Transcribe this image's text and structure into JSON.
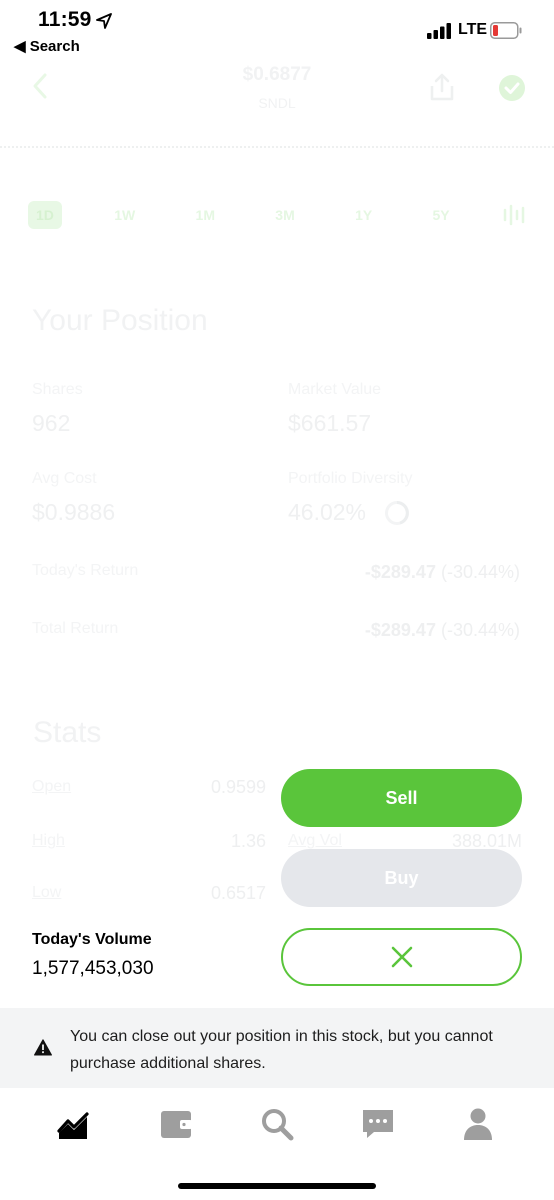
{
  "status_bar": {
    "time": "11:59",
    "back_label": "◀ Search",
    "network": "LTE"
  },
  "header": {
    "price": "$0.6877",
    "symbol": "SNDL"
  },
  "ranges": [
    "1D",
    "1W",
    "1M",
    "3M",
    "1Y",
    "5Y"
  ],
  "position": {
    "title": "Your Position",
    "shares_label": "Shares",
    "shares_value": "962",
    "market_value_label": "Market Value",
    "market_value": "$661.57",
    "avg_cost_label": "Avg Cost",
    "avg_cost": "$0.9886",
    "diversity_label": "Portfolio Diversity",
    "diversity": "46.02%",
    "todays_return_label": "Today's Return",
    "todays_return_amount": "-$289.47",
    "todays_return_pct": "(-30.44%)",
    "total_return_label": "Total Return",
    "total_return_amount": "-$289.47",
    "total_return_pct": "(-30.44%)"
  },
  "stats": {
    "title": "Stats",
    "open_label": "Open",
    "open_value": "0.9599",
    "high_label": "High",
    "high_value": "1.36",
    "low_label": "Low",
    "low_value": "0.6517",
    "avg_vol_label": "Avg Vol",
    "avg_vol_value": "388.01M"
  },
  "volume": {
    "label": "Today's Volume",
    "value": "1,577,453,030"
  },
  "actions": {
    "sell": "Sell",
    "buy": "Buy"
  },
  "notice": {
    "text": "You can close out your position in this stock, but you cannot purchase additional shares."
  },
  "colors": {
    "accent_green": "#5ac53b",
    "disabled_gray": "#e5e7eb",
    "notice_bg": "#f3f4f5"
  }
}
